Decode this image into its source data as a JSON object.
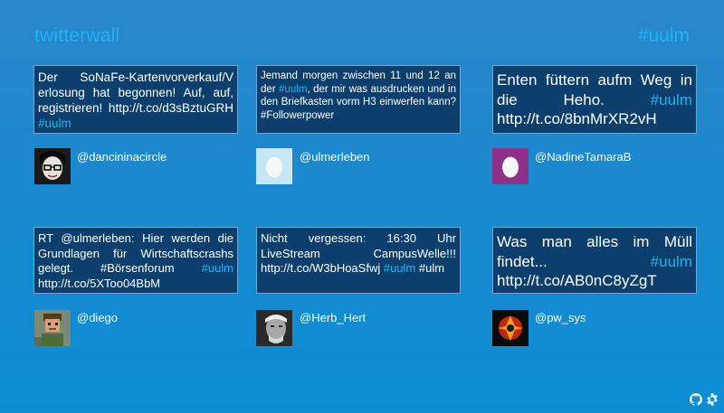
{
  "header": {
    "title": "twitterwall",
    "hashtag": "#uulm"
  },
  "tweets": [
    {
      "parts": [
        "Der SoNaFe-Kartenvorverkauf/V erlosung hat begonnen! Auf, auf, registrieren! http://t.co/d3sBztuGRH ",
        "#uulm",
        ""
      ],
      "user": "@dancininacircle",
      "avatar": "woman-glasses-avatar"
    },
    {
      "parts": [
        "Jemand morgen zwischen 11 und 12 an der ",
        "#uulm",
        ", der mir was ausdrucken und in den Briefkasten vorm H3 einwerfen kann? #Followerpower"
      ],
      "user": "@ulmerleben",
      "avatar": "egg-avatar"
    },
    {
      "parts": [
        "Enten füttern aufm Weg in die Heho. ",
        "#uulm",
        " http://t.co/8bnMrXR2vH"
      ],
      "user": "@NadineTamaraB",
      "avatar": "egg-avatar"
    },
    {
      "parts": [
        "RT @ulmerleben: Hier werden die Grundlagen für Wirtschaftscrashs gelegt. #Börsenforum ",
        "#uulm",
        " http://t.co/5XToo04BbM"
      ],
      "user": "@diego",
      "avatar": "pixel-person-avatar"
    },
    {
      "parts": [
        "Nicht vergessen: 16:30 Uhr LiveStream CampusWelle!!! http://t.co/W3bHoaSfwj ",
        "#uulm",
        " #ulm"
      ],
      "user": "@Herb_Hert",
      "avatar": "bw-portrait-avatar"
    },
    {
      "parts": [
        "Was man alles im Müll findet... ",
        "#uulm",
        " http://t.co/AB0nC8yZgT"
      ],
      "user": "@pw_sys",
      "avatar": "emblem-avatar"
    }
  ],
  "footer": {
    "icons": [
      "github-icon",
      "gear-icon"
    ]
  }
}
